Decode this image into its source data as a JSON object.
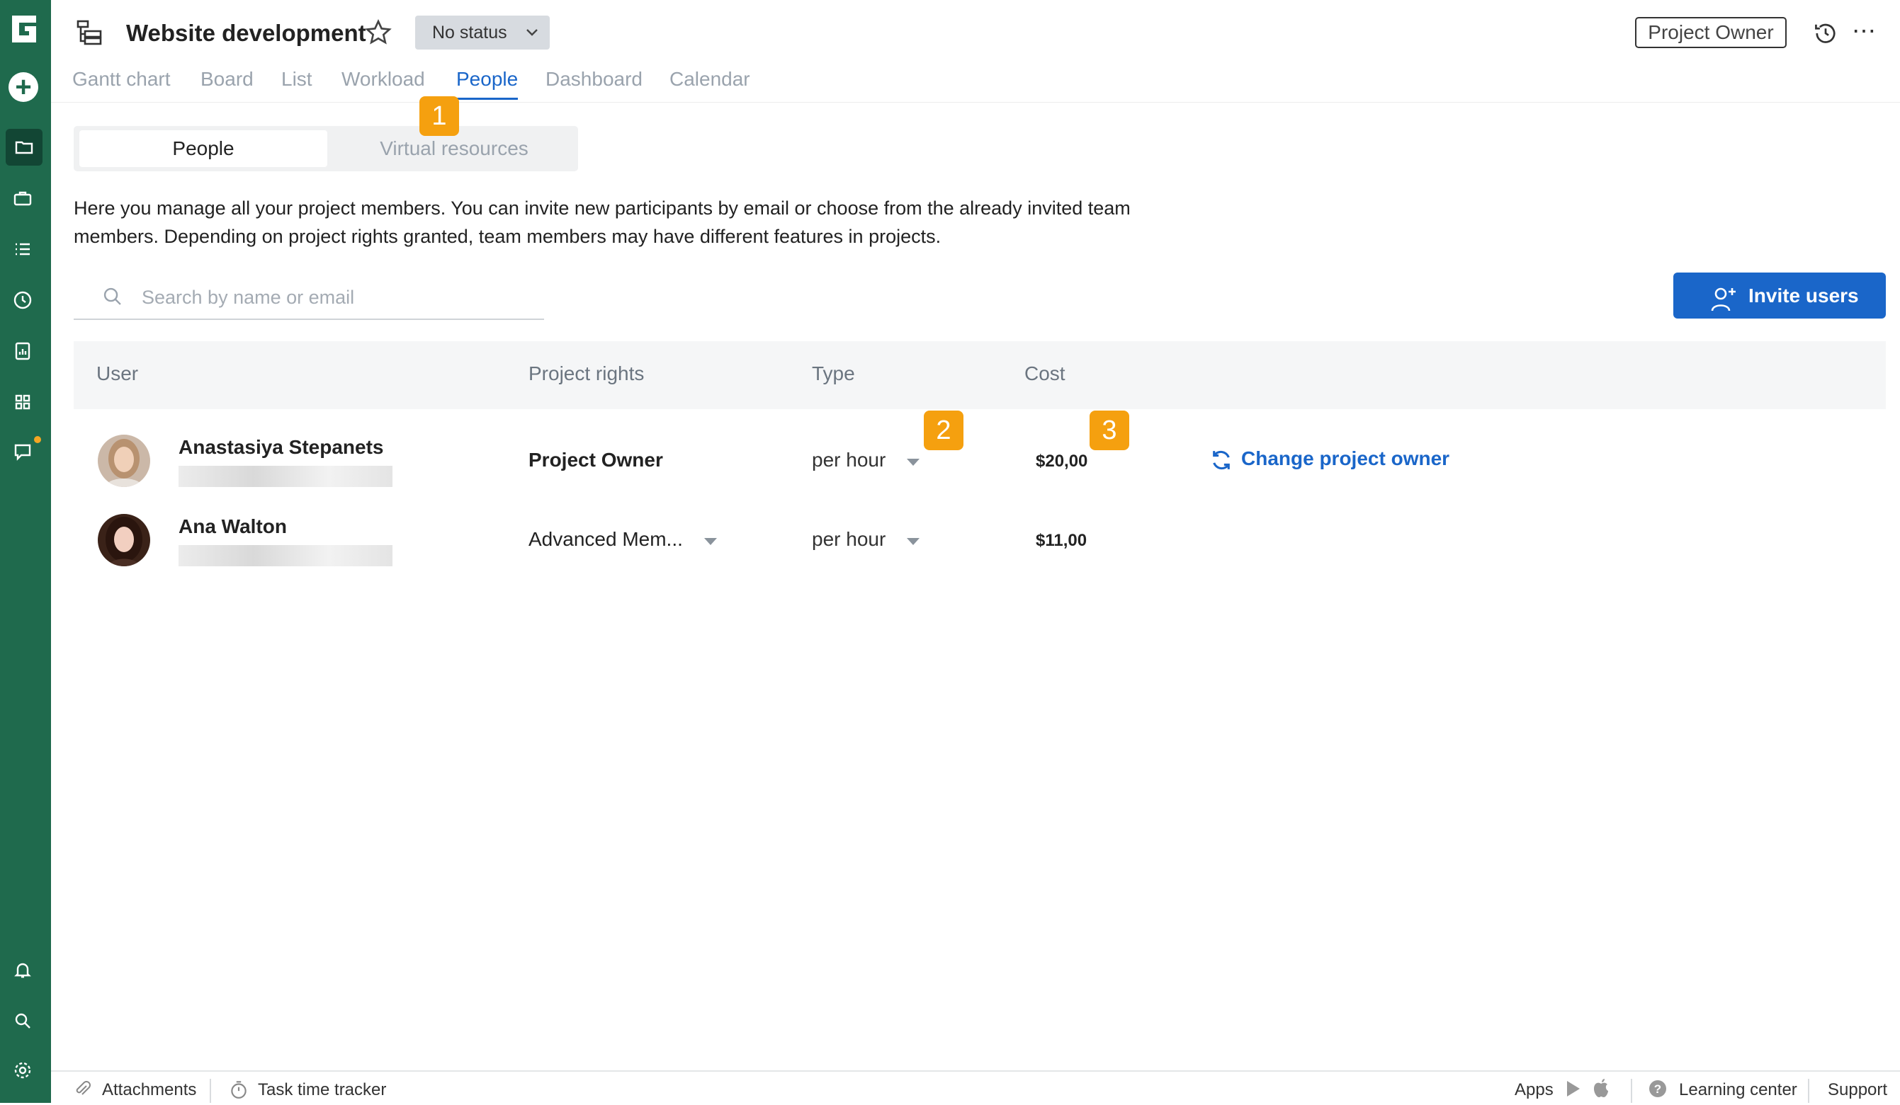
{
  "project": {
    "title": "Website development",
    "status": "No status",
    "role_button": "Project Owner"
  },
  "tabs": [
    "Gantt chart",
    "Board",
    "List",
    "Workload",
    "People",
    "Dashboard",
    "Calendar"
  ],
  "active_tab": "People",
  "segmented": {
    "people": "People",
    "virtual": "Virtual resources"
  },
  "description": "Here you manage all your project members. You can invite new participants by email or choose from the already invited team members. Depending on project rights granted, team members may have different features in projects.",
  "search": {
    "placeholder": "Search by name or email"
  },
  "invite_label": "Invite users",
  "table": {
    "headers": {
      "user": "User",
      "rights": "Project rights",
      "type": "Type",
      "cost": "Cost"
    },
    "rows": [
      {
        "name": "Anastasiya Stepanets",
        "rights": "Project Owner",
        "type": "per hour",
        "cost": "$20,00",
        "action": "Change project owner"
      },
      {
        "name": "Ana Walton",
        "rights": "Advanced Mem...",
        "type": "per hour",
        "cost": "$11,00"
      }
    ]
  },
  "badges": [
    "1",
    "2",
    "3"
  ],
  "footer": {
    "attachments": "Attachments",
    "tracker": "Task time tracker",
    "apps": "Apps",
    "learning": "Learning center",
    "support": "Support"
  },
  "colors": {
    "rail": "#1f6a4d",
    "accent": "#1a66c9",
    "badge": "#f5a00f",
    "notification": "#f5a623"
  },
  "icons": [
    "logo-icon",
    "plus-icon",
    "folder-icon",
    "briefcase-icon",
    "list-icon",
    "clock-icon",
    "report-icon",
    "apps-grid-icon",
    "chat-icon",
    "bell-icon",
    "search-icon",
    "settings-icon",
    "project-tree-icon",
    "star-icon",
    "chevron-down-icon",
    "history-icon",
    "more-icon",
    "add-user-icon",
    "refresh-icon",
    "paperclip-icon",
    "timer-icon",
    "play-store-icon",
    "apple-icon",
    "help-icon"
  ]
}
